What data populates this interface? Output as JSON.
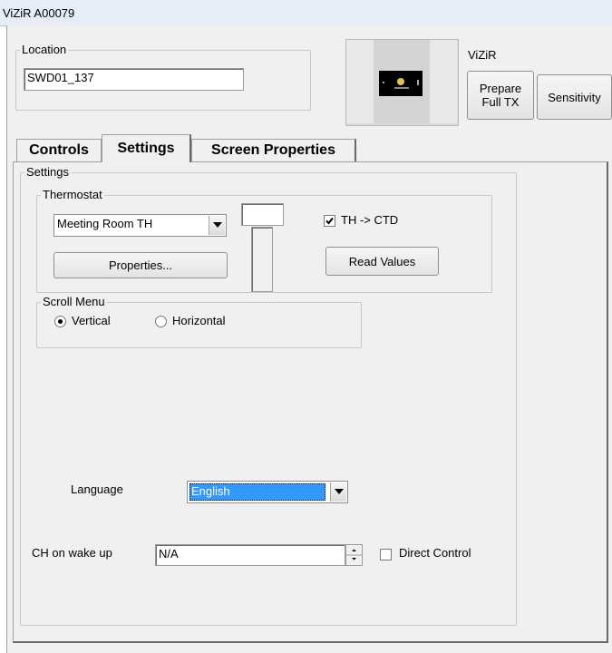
{
  "window": {
    "title": "ViZiR A00079"
  },
  "location": {
    "label": "Location",
    "value": "SWD01_137"
  },
  "device": {
    "name": "ViZiR"
  },
  "buttons": {
    "prepare_full_tx": "Prepare Full TX",
    "sensitivity": "Sensitivity"
  },
  "tabs": [
    {
      "label": "Controls"
    },
    {
      "label": "Settings",
      "selected": true
    },
    {
      "label": "Screen Properties"
    }
  ],
  "settings": {
    "group_label": "Settings",
    "thermostat": {
      "group_label": "Thermostat",
      "selected": "Meeting Room TH",
      "properties_button": "Properties...",
      "th_ctd_label": "TH -> CTD",
      "th_ctd_checked": true,
      "read_values_button": "Read Values"
    },
    "scroll_menu": {
      "group_label": "Scroll Menu",
      "vertical_label": "Vertical",
      "horizontal_label": "Horizontal",
      "selected": "Vertical"
    },
    "language": {
      "label": "Language",
      "selected": "English"
    },
    "ch_on_wake_up": {
      "label": "CH on wake up",
      "value": "N/A"
    },
    "direct_control": {
      "label": "Direct Control",
      "checked": false
    }
  },
  "colors": {
    "selection": "#3399ff",
    "window_bg": "#f0f0f0",
    "titlebar": "#e6edf6"
  }
}
